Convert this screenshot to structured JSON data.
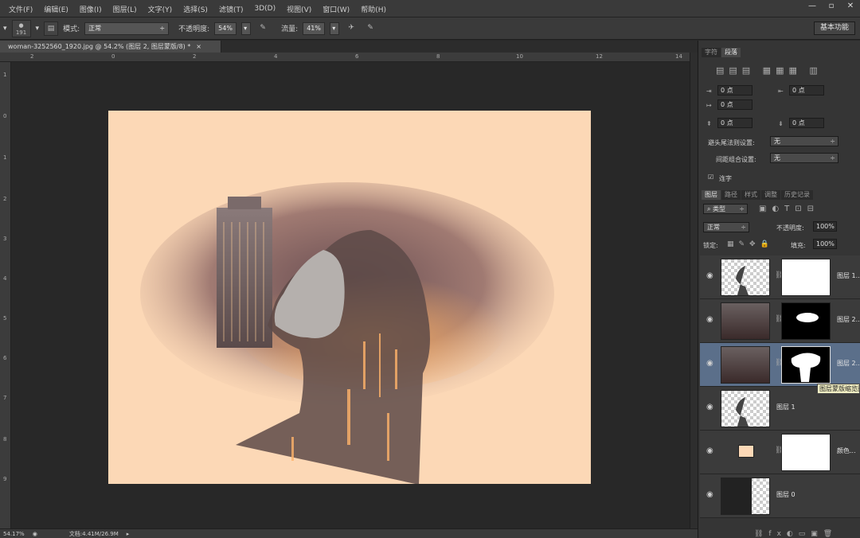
{
  "menubar": {
    "items": [
      "文件(F)",
      "编辑(E)",
      "图像(I)",
      "图层(L)",
      "文字(Y)",
      "选择(S)",
      "滤镜(T)",
      "3D(D)",
      "视图(V)",
      "窗口(W)",
      "帮助(H)"
    ],
    "window_controls": [
      "—",
      "▫",
      "✕"
    ]
  },
  "options": {
    "brush_size": "191",
    "mode_label": "模式:",
    "mode_value": "正常",
    "opacity_label": "不透明度:",
    "opacity_value": "54%",
    "flow_label": "流量:",
    "flow_value": "41%",
    "workspace_button": "基本功能"
  },
  "document": {
    "tab_title": "woman-3252560_1920.jpg @ 54.2% (图层 2, 图层蒙版/8) *",
    "tab_close": "×",
    "artboard_color": "#fcd8b6"
  },
  "rulers": {
    "top": [
      "2",
      "0",
      "2",
      "4",
      "6",
      "8",
      "10",
      "12",
      "14"
    ],
    "left": [
      "1",
      "0",
      "1",
      "2",
      "3",
      "4",
      "5",
      "6",
      "7",
      "8",
      "9"
    ]
  },
  "statusbar": {
    "zoom": "54.17%",
    "doc_info": "文档:4.41M/26.9M"
  },
  "paragraph_panel": {
    "tabs": [
      "字符",
      "段落"
    ],
    "active_tab": "段落",
    "fields": [
      "0 点",
      "0 点",
      "0 点",
      "0 点",
      "0 点"
    ],
    "hanging_label": "避头尾法则设置:",
    "hanging_value": "无",
    "spacing_label": "间距组合设置:",
    "spacing_value": "无",
    "hyphenate_label": "连字"
  },
  "layers_panel": {
    "tabs": [
      "图层",
      "路径",
      "样式",
      "调整",
      "历史记录"
    ],
    "active_tab": "图层",
    "filter_value": "类型",
    "blend_mode": "正常",
    "opacity_label": "不透明度:",
    "opacity_value": "100%",
    "lock_label": "锁定:",
    "fill_label": "填充:",
    "fill_value": "100%",
    "layers": [
      {
        "name": "图层 1..."
      },
      {
        "name": "图层 2..."
      },
      {
        "name": "图层 2..."
      },
      {
        "name": "图层 1"
      },
      {
        "name": "颜色..."
      },
      {
        "name": "图层 0"
      }
    ],
    "tooltip": "图层蒙版缩览图"
  }
}
